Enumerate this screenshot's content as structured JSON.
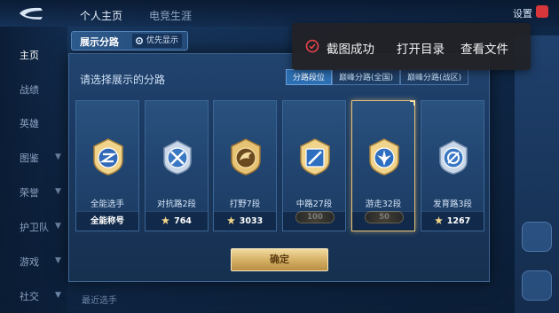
{
  "background": {
    "tabs": [
      "个人主页",
      "电竞生涯"
    ],
    "settings_label": "设置",
    "sidebar": [
      {
        "label": "主页",
        "active": true,
        "chevron": false
      },
      {
        "label": "战绩",
        "active": false,
        "chevron": false
      },
      {
        "label": "英雄",
        "active": false,
        "chevron": false
      },
      {
        "label": "图鉴",
        "active": false,
        "chevron": true
      },
      {
        "label": "荣誉",
        "active": false,
        "chevron": true
      },
      {
        "label": "护卫队",
        "active": false,
        "chevron": true
      },
      {
        "label": "游戏",
        "active": false,
        "chevron": true
      },
      {
        "label": "社交",
        "active": false,
        "chevron": true
      }
    ],
    "bottom_text": "最近选手"
  },
  "modal": {
    "title": "展示分路",
    "priority_label": "优先显示",
    "heading": "请选择展示的分路",
    "segment_tabs": [
      {
        "label": "分路段位",
        "active": true
      },
      {
        "label": "巅峰分路(全国)",
        "active": false
      },
      {
        "label": "巅峰分路(战区)",
        "active": false
      }
    ],
    "cards": [
      {
        "label": "全能选手",
        "footer": "全能称号",
        "stars": "",
        "badge": "",
        "selected": false,
        "emblem": "all-round"
      },
      {
        "label": "对抗路2段",
        "footer": "",
        "stars": "764",
        "badge": "",
        "selected": false,
        "emblem": "clash-lane"
      },
      {
        "label": "打野7段",
        "footer": "",
        "stars": "3033",
        "badge": "",
        "selected": false,
        "emblem": "jungle"
      },
      {
        "label": "中路27段",
        "footer": "",
        "stars": "",
        "badge": "100",
        "selected": false,
        "emblem": "mid-lane"
      },
      {
        "label": "游走32段",
        "footer": "",
        "stars": "",
        "badge": "50",
        "selected": true,
        "emblem": "roam"
      },
      {
        "label": "发育路3段",
        "footer": "",
        "stars": "1267",
        "badge": "",
        "selected": false,
        "emblem": "farm-lane"
      }
    ],
    "confirm_label": "确定"
  },
  "toast": {
    "message": "截图成功",
    "open_folder": "打开目录",
    "view_file": "查看文件",
    "icon_color": "#e8454a"
  },
  "colors": {
    "accent_gold": "#d3ad62",
    "active_tab": "#2d6fb3"
  }
}
